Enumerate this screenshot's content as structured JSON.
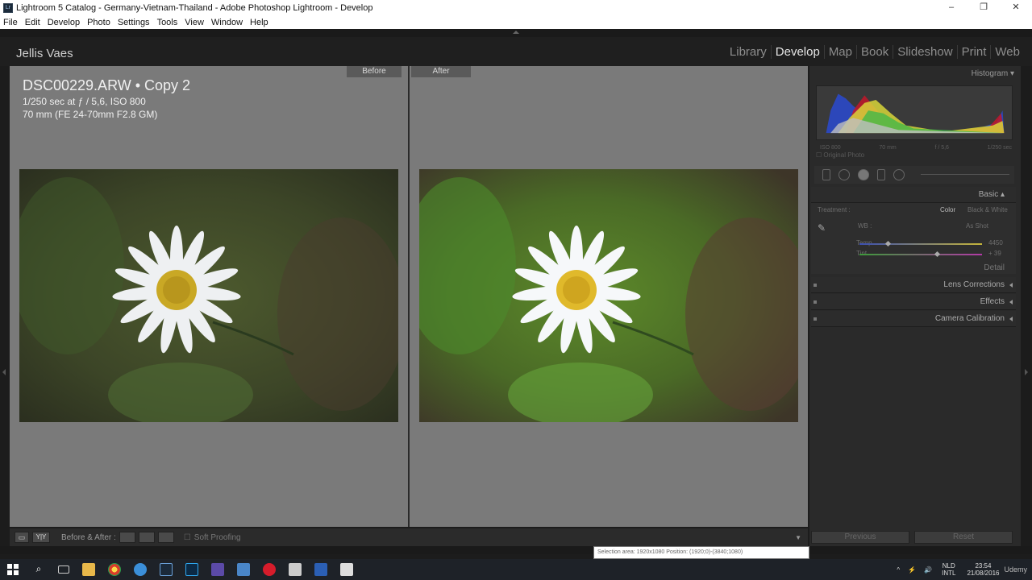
{
  "window": {
    "title": "Lightroom 5 Catalog - Germany-Vietnam-Thailand - Adobe Photoshop Lightroom - Develop",
    "app_icon": "Lr",
    "controls": [
      "–",
      "❐",
      "✕"
    ]
  },
  "menubar": [
    "File",
    "Edit",
    "Develop",
    "Photo",
    "Settings",
    "Tools",
    "View",
    "Window",
    "Help"
  ],
  "identity_plate": "Jellis Vaes",
  "modules": [
    "Library",
    "Develop",
    "Map",
    "Book",
    "Slideshow",
    "Print",
    "Web"
  ],
  "active_module": "Develop",
  "compare": {
    "before_label": "Before",
    "after_label": "After"
  },
  "photo_info": {
    "filename": "DSC00229.ARW  •  Copy 2",
    "exposure": "1/250 sec at ƒ / 5,6, ISO 800",
    "lens": "70 mm (FE 24-70mm F2.8 GM)"
  },
  "histogram": {
    "title": "Histogram",
    "iso": "ISO 800",
    "focal": "70 mm",
    "aperture": "f / 5,6",
    "shutter": "1/250 sec",
    "original_photo_label": "Original Photo"
  },
  "basic": {
    "title": "Basic",
    "treatment_label": "Treatment :",
    "treatment_color": "Color",
    "treatment_bw": "Black & White",
    "wb_label": "WB :",
    "wb_value": "As Shot",
    "temp_label": "Temp",
    "temp_value": "4450",
    "tint_label": "Tint",
    "tint_value": "+ 39",
    "temp_level": 0.22,
    "tint_level": 0.62,
    "detail_label": "Detail"
  },
  "sections": [
    "Lens Corrections",
    "Effects",
    "Camera Calibration"
  ],
  "toolbar": {
    "view_icons": [
      "▭",
      "Y|Y"
    ],
    "before_after_label": "Before & After :",
    "soft_proofing_label": "Soft Proofing"
  },
  "buttons": {
    "previous": "Previous",
    "reset": "Reset"
  },
  "tooltip": "Selection area: 1920x1080 Position: (1920;0)-(3840;1080)",
  "taskbar": {
    "lang_top": "NLD",
    "lang_bottom": "INTL",
    "time": "23:54",
    "date": "21/08/2016",
    "watermark": "Udemy"
  }
}
